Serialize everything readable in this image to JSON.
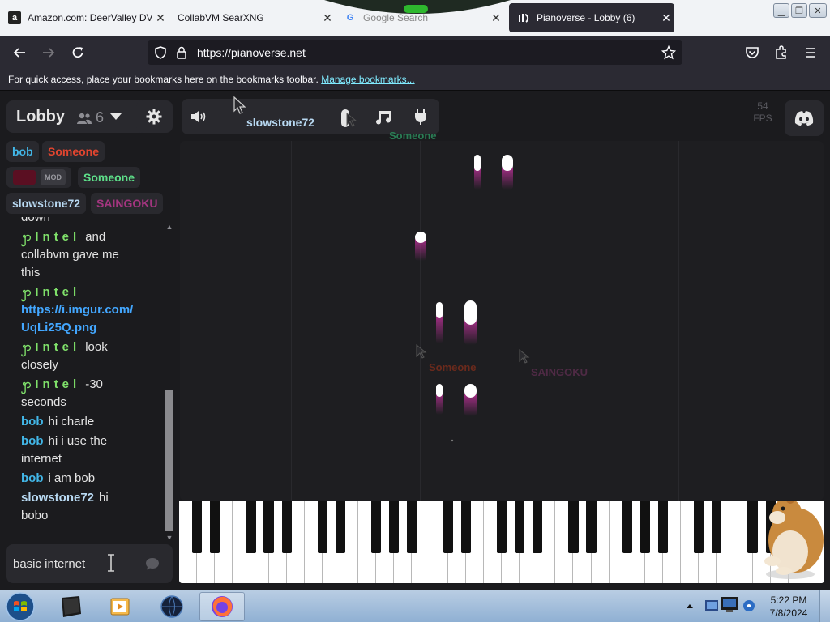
{
  "browser": {
    "tabs": [
      {
        "label": "Amazon.com: DeerValley DV",
        "favicon": "amazon-icon",
        "active": false
      },
      {
        "label": "CollabVM SearXNG",
        "favicon": "none",
        "active": false
      },
      {
        "label": "Google Search",
        "favicon": "google-icon",
        "active": false
      },
      {
        "label": "Pianoverse - Lobby (6)",
        "favicon": "pianoverse-icon",
        "active": true
      }
    ],
    "url": "https://pianoverse.net",
    "bookmarks_message": "For quick access, place your bookmarks here on the bookmarks toolbar.",
    "bookmarks_link": "Manage bookmarks..."
  },
  "lobby": {
    "name": "Lobby",
    "user_count": "6"
  },
  "users": [
    {
      "name": "bob",
      "color": "#42b7e8"
    },
    {
      "name": "Someone",
      "color": "#e2452f"
    },
    {
      "name": "",
      "color": "#7a1030",
      "badge": "MOD"
    },
    {
      "name": "Someone",
      "color": "#5ee08a"
    },
    {
      "name": "slowstone72",
      "color": "#b8d9f2"
    },
    {
      "name": "SAINGOKU",
      "color": "#a3357f"
    }
  ],
  "chat": {
    "partial_text": "down",
    "messages": [
      {
        "name": "Intel",
        "name_color": "#7fe06a",
        "text": "and collabvm gave me this"
      },
      {
        "name": "Intel",
        "name_color": "#7fe06a",
        "text": "",
        "link": "https://i.imgur.com/UqLi25Q.png"
      },
      {
        "name": "Intel",
        "name_color": "#7fe06a",
        "text": "look closely"
      },
      {
        "name": "Intel",
        "name_color": "#7fe06a",
        "text": "-30 seconds"
      },
      {
        "name": "bob",
        "name_color": "#42b7e8",
        "text": "hi charle"
      },
      {
        "name": "bob",
        "name_color": "#42b7e8",
        "text": "hi i use the internet"
      },
      {
        "name": "bob",
        "name_color": "#42b7e8",
        "text": "i am bob"
      },
      {
        "name": "slowstone72",
        "name_color": "#b8d9f2",
        "text": "hi bobo"
      }
    ],
    "input_value": "basic internet"
  },
  "toolbar": {
    "current_user": "slowstone72"
  },
  "fps": {
    "value": "54",
    "label": "FPS"
  },
  "cursors": [
    {
      "name": "Someone",
      "color": "#2a7d55"
    },
    {
      "name": "Someone",
      "color": "#6b2a1c"
    },
    {
      "name": "SAINGOKU",
      "color": "#4f2a45"
    }
  ],
  "taskbar": {
    "time": "5:22 PM",
    "date": "7/8/2024"
  },
  "colors": {
    "note_glow": "#c0319b",
    "page_bg": "#1b1b1e",
    "panel_bg": "#29292e"
  }
}
